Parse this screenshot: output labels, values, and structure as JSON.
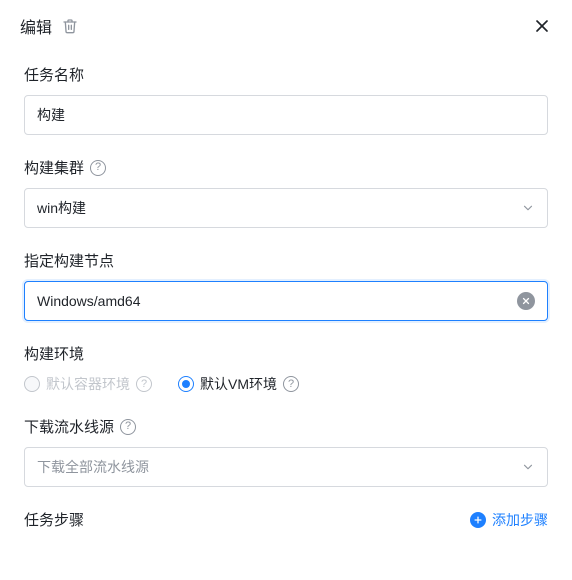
{
  "header": {
    "title": "编辑"
  },
  "fields": {
    "task_name": {
      "label": "任务名称",
      "value": "构建"
    },
    "build_cluster": {
      "label": "构建集群",
      "value": "win构建"
    },
    "build_node": {
      "label": "指定构建节点",
      "value": "Windows/amd64"
    },
    "build_env": {
      "label": "构建环境",
      "option_container": "默认容器环境",
      "option_vm": "默认VM环境"
    },
    "pipeline_source": {
      "label": "下载流水线源",
      "placeholder": "下载全部流水线源"
    },
    "steps": {
      "label": "任务步骤",
      "add_label": "添加步骤"
    }
  }
}
